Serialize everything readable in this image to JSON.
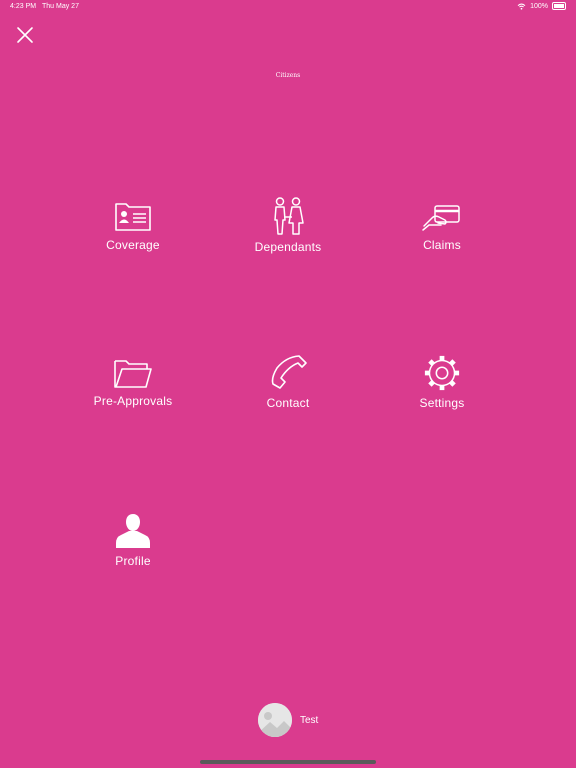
{
  "status_bar": {
    "time": "4:23 PM",
    "date": "Thu May 27",
    "battery": "100%"
  },
  "logo_text": "Citizens",
  "menu": {
    "coverage": "Coverage",
    "dependants": "Dependants",
    "claims": "Claims",
    "preapprovals": "Pre-Approvals",
    "contact": "Contact",
    "settings": "Settings",
    "profile": "Profile"
  },
  "user": {
    "name": "Test"
  },
  "colors": {
    "background": "#da3b8e",
    "foreground": "#ffffff"
  },
  "icons": {
    "close": "close-icon",
    "coverage": "id-card-icon",
    "dependants": "couple-icon",
    "claims": "hand-card-icon",
    "preapprovals": "folder-icon",
    "contact": "phone-icon",
    "settings": "gear-icon",
    "profile": "person-icon"
  }
}
